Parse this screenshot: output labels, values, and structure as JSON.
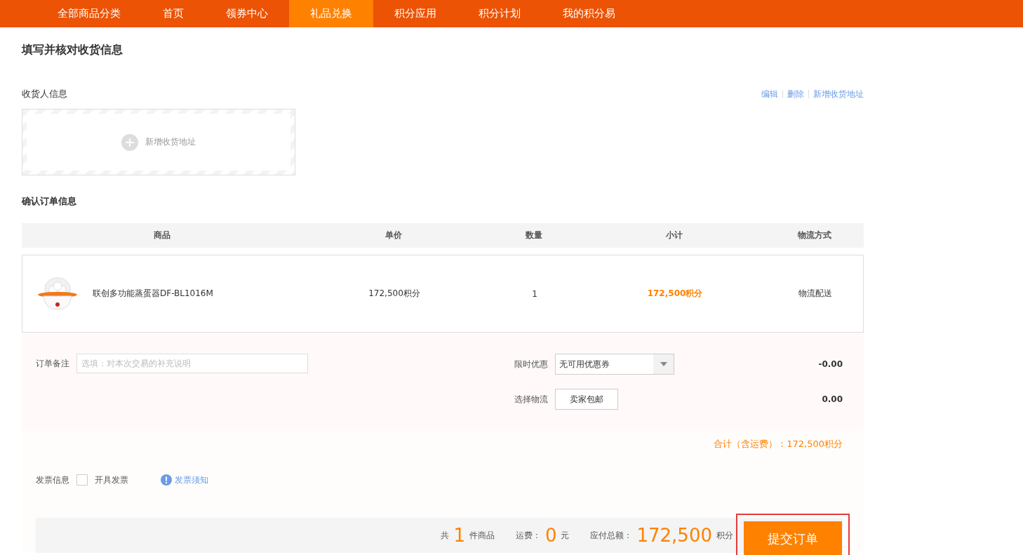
{
  "nav": [
    {
      "label": "全部商品分类",
      "selected": false
    },
    {
      "label": "首页",
      "selected": false
    },
    {
      "label": "领券中心",
      "selected": false
    },
    {
      "label": "礼品兑换",
      "selected": true
    },
    {
      "label": "积分应用",
      "selected": false
    },
    {
      "label": "积分计划",
      "selected": false
    },
    {
      "label": "我的积分易",
      "selected": false
    }
  ],
  "title": "填写并核对收货信息",
  "receiver": {
    "label": "收货人信息",
    "actions": [
      "编辑",
      "删除",
      "新增收货地址"
    ],
    "add_label": "新增收货地址"
  },
  "order": {
    "title": "确认订单信息",
    "columns": [
      "商品",
      "单价",
      "数量",
      "小计",
      "物流方式"
    ],
    "rows": [
      {
        "name": "联创多功能蒸蛋器DF-BL1016M",
        "price": "172,500积分",
        "qty": "1",
        "subtotal": "172,500积分",
        "shipping": "物流配送"
      }
    ]
  },
  "remark": {
    "label": "订单备注",
    "placeholder": "选填：对本次交易的补充说明"
  },
  "coupon": {
    "label": "限时优惠",
    "value": "无可用优惠券",
    "amount": "-0.00"
  },
  "logistics": {
    "label": "选择物流",
    "option": "卖家包邮",
    "amount": "0.00"
  },
  "total": "合计（含运费）：172,500积分",
  "invoice": {
    "label": "发票信息",
    "checked": false,
    "option": "开具发票",
    "notice": "发票须知"
  },
  "summary": {
    "count_prefix": "共",
    "count": "1",
    "count_suffix": "件商品",
    "freight_label": "运费：",
    "freight": "0",
    "freight_unit": "元",
    "due_label": "应付总额：",
    "due": "172,500",
    "due_unit": "积分",
    "submit": "提交订单"
  }
}
